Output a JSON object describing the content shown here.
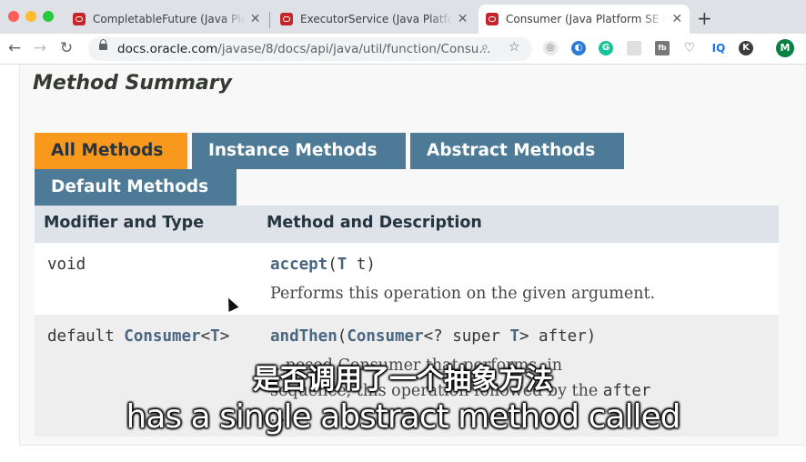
{
  "browser": {
    "tabs": [
      {
        "title": "CompletableFuture (Java Platform SE 8 )",
        "active": false
      },
      {
        "title": "ExecutorService (Java Platform SE 8 )",
        "active": false
      },
      {
        "title": "Consumer (Java Platform SE 8 )",
        "active": true
      }
    ],
    "address": {
      "domain": "docs.oracle.com",
      "path": "/javase/8/docs/api/java/util/function/Consu..."
    },
    "profile_initial": "M",
    "extension_labels": {
      "iq": "IQ",
      "k": "K",
      "g": "G",
      "fb": "fb"
    }
  },
  "page": {
    "heading": "Method Summary",
    "method_tabs": [
      "All Methods",
      "Instance Methods",
      "Abstract Methods",
      "Default Methods"
    ],
    "columns": [
      "Modifier and Type",
      "Method and Description"
    ],
    "rows": [
      {
        "modifier": "void",
        "method_name": "accept",
        "method_signature_open": "(",
        "method_type_param": "T",
        "method_signature_rest": " t)",
        "description": "Performs this operation on the given argument."
      },
      {
        "modifier_prefix": "default ",
        "modifier_type": "Consumer",
        "modifier_lt": "<",
        "modifier_type_param": "T",
        "modifier_gt": ">",
        "method_name": "andThen",
        "method_open": "(",
        "method_param_type": "Consumer",
        "method_mid": "<? super ",
        "method_param_tp": "T",
        "method_end": "> after)",
        "description_line1": "...posed Consumer that performs, in",
        "description_line2_a": "sequence, this operation followed by the ",
        "description_line2_b": "after",
        "description_line3": "..."
      }
    ]
  },
  "subtitles": {
    "chinese": "是否调用了一个抽象方法",
    "english": "has a single abstract method called"
  }
}
